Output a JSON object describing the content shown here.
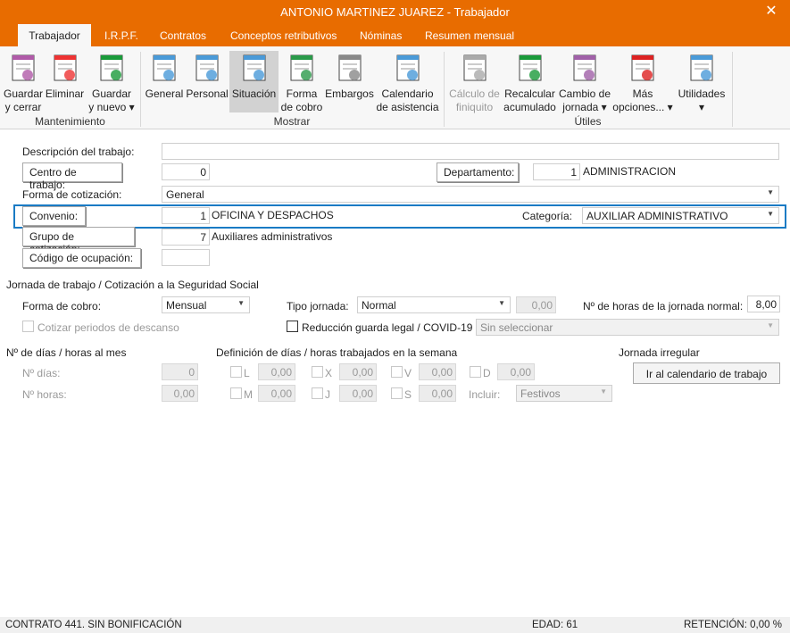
{
  "window": {
    "title": "ANTONIO MARTINEZ JUAREZ - Trabajador",
    "close": "✕"
  },
  "tabs": [
    "Trabajador",
    "I.R.P.F.",
    "Contratos",
    "Conceptos retributivos",
    "Nóminas",
    "Resumen mensual"
  ],
  "ribbon": {
    "groups": [
      "Mantenimiento",
      "Mostrar",
      "Útiles"
    ],
    "mantenimiento": [
      {
        "l1": "Guardar",
        "l2": "y cerrar"
      },
      {
        "l1": "Eliminar",
        "l2": ""
      },
      {
        "l1": "Guardar",
        "l2": "y nuevo ▾"
      }
    ],
    "mostrar": [
      {
        "l1": "General",
        "l2": ""
      },
      {
        "l1": "Personal",
        "l2": ""
      },
      {
        "l1": "Situación",
        "l2": ""
      },
      {
        "l1": "Forma",
        "l2": "de cobro"
      },
      {
        "l1": "Embargos",
        "l2": ""
      },
      {
        "l1": "Calendario",
        "l2": "de asistencia"
      }
    ],
    "utiles": [
      {
        "l1": "Cálculo de",
        "l2": "finiquito"
      },
      {
        "l1": "Recalcular",
        "l2": "acumulado"
      },
      {
        "l1": "Cambio de",
        "l2": "jornada ▾"
      },
      {
        "l1": "Más",
        "l2": "opciones... ▾"
      },
      {
        "l1": "Utilidades",
        "l2": "▾"
      }
    ]
  },
  "form": {
    "descripcion_label": "Descripción del trabajo:",
    "descripcion_value": "",
    "centro_btn": "Centro de trabajo:",
    "centro_value": "0",
    "departamento_btn": "Departamento:",
    "departamento_value": "1",
    "departamento_name": "ADMINISTRACION",
    "forma_cotizacion_label": "Forma de cotización:",
    "forma_cotizacion_value": "General",
    "convenio_btn": "Convenio:",
    "convenio_value": "1",
    "convenio_name": "OFICINA Y DESPACHOS",
    "categoria_label": "Categoría:",
    "categoria_value": "AUXILIAR ADMINISTRATIVO",
    "grupo_btn": "Grupo de cotización:",
    "grupo_value": "7",
    "grupo_name": "Auxiliares administrativos",
    "codigo_btn": "Código de ocupación:",
    "codigo_value": ""
  },
  "jornada": {
    "heading": "Jornada de trabajo / Cotización a la Seguridad Social",
    "forma_cobro_label": "Forma de cobro:",
    "forma_cobro_value": "Mensual",
    "tipo_label": "Tipo jornada:",
    "tipo_value": "Normal",
    "tipo_num": "0,00",
    "horas_label": "Nº de horas de la jornada normal:",
    "horas_value": "8,00",
    "cotizar_label": "Cotizar periodos de descanso",
    "reduccion_label": "Reducción guarda legal / COVID-19",
    "reduccion_value": "Sin seleccionar"
  },
  "mes": {
    "heading": "Nº de días / horas al mes",
    "dias_label": "Nº días:",
    "dias_value": "0",
    "horas_label": "Nº horas:",
    "horas_value": "0,00"
  },
  "semana": {
    "heading": "Definición de días / horas trabajados en la semana",
    "days": [
      {
        "d": "L",
        "v": "0,00"
      },
      {
        "d": "X",
        "v": "0,00"
      },
      {
        "d": "V",
        "v": "0,00"
      },
      {
        "d": "D",
        "v": "0,00"
      },
      {
        "d": "M",
        "v": "0,00"
      },
      {
        "d": "J",
        "v": "0,00"
      },
      {
        "d": "S",
        "v": "0,00"
      }
    ],
    "incluir_label": "Incluir:",
    "incluir_value": "Festivos"
  },
  "irregular": {
    "heading": "Jornada irregular",
    "button": "Ir al calendario de trabajo"
  },
  "status": {
    "contrato": "CONTRATO 441.  SIN BONIFICACIÓN",
    "edad": "EDAD: 61",
    "retencion": "RETENCIÓN: 0,00 %"
  },
  "colors": {
    "titlebar": "#e86c00",
    "highlight": "#1a7bc4"
  }
}
